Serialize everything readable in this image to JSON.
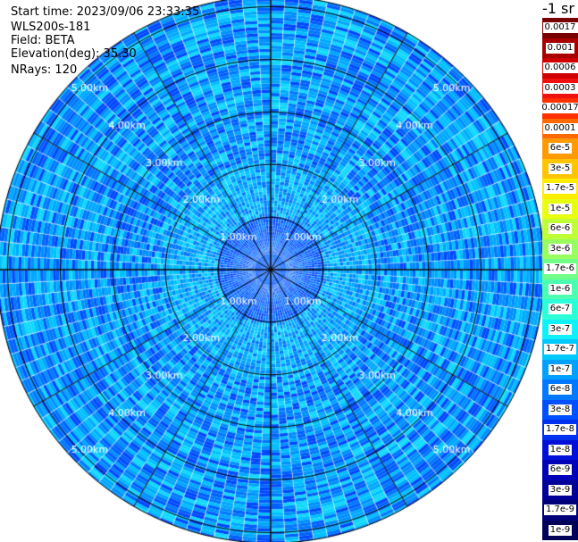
{
  "header": {
    "start_time": "Start time: 2023/09/06 23:33:35",
    "instrument": "WLS200s-181",
    "field": "Field: BETA",
    "elevation": "Elevation(deg): 35.30",
    "nrays": "NRays: 120"
  },
  "colorbar": {
    "unit": "-1 sr",
    "labels": [
      "0.0017",
      "0.001",
      "0.0006",
      "0.0003",
      "0.00017",
      "0.0001",
      "6e-5",
      "3e-5",
      "1.7e-5",
      "1e-5",
      "6e-6",
      "3e-6",
      "1.7e-6",
      "1e-6",
      "6e-7",
      "3e-7",
      "1.7e-7",
      "1e-7",
      "6e-8",
      "3e-8",
      "1.7e-8",
      "1e-8",
      "6e-9",
      "3e-9",
      "1.7e-9",
      "1e-9"
    ],
    "colors": [
      "#7a0000",
      "#a80000",
      "#d00000",
      "#f01010",
      "#ff3000",
      "#ff6a00",
      "#ff9a00",
      "#ffc400",
      "#ffee00",
      "#e8ff10",
      "#c0ff38",
      "#98ff60",
      "#72ff88",
      "#4cffb0",
      "#2cffd8",
      "#10f0f8",
      "#00c8ff",
      "#00a0ff",
      "#0078ff",
      "#0050ff",
      "#0030f0",
      "#0010d8",
      "#0000b8",
      "#000098",
      "#000078",
      "#000058"
    ]
  },
  "chart_data": {
    "type": "ppi",
    "field": "BETA",
    "elevation_deg": 35.3,
    "nrays": 120,
    "range_unit": "km",
    "ring_labels": [
      "1.00km",
      "2.00km",
      "3.00km",
      "4.00km",
      "5.00km"
    ],
    "rings_km": [
      1,
      2,
      3,
      4,
      5
    ],
    "max_range_km": 5.2,
    "dominant_band": "1e-8 to 1e-7",
    "spoke_angles_deg": [
      0,
      30,
      60,
      90,
      120,
      150,
      180,
      210,
      240,
      270,
      300,
      330
    ]
  }
}
